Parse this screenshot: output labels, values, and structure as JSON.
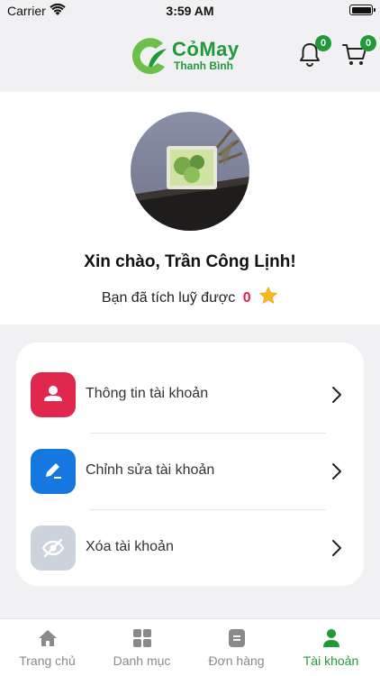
{
  "status_bar": {
    "carrier": "Carrier",
    "time": "3:59 AM"
  },
  "header": {
    "logo_name": "CỏMay",
    "logo_sub": "Thanh Bình",
    "notification_count": "0",
    "cart_count": "0",
    "brand_color": "#1f9a3b"
  },
  "profile": {
    "greeting": "Xin chào, Trần Công Lịnh!",
    "points_prefix": "Bạn đã tích luỹ được",
    "points_value": "0",
    "points_color": "#e01f4f"
  },
  "menu": {
    "items": [
      {
        "label": "Thông tin tài khoản",
        "icon": "user-icon",
        "color": "#e0284f"
      },
      {
        "label": "Chỉnh sửa tài khoản",
        "icon": "edit-icon",
        "color": "#1677e0"
      },
      {
        "label": "Xóa tài khoản",
        "icon": "eye-off-icon",
        "color": "#cdd3dd"
      }
    ]
  },
  "tabs": [
    {
      "label": "Trang chủ",
      "icon": "home-icon",
      "active": false
    },
    {
      "label": "Danh mục",
      "icon": "grid-icon",
      "active": false
    },
    {
      "label": "Đơn hàng",
      "icon": "order-icon",
      "active": false
    },
    {
      "label": "Tài khoản",
      "icon": "user-icon",
      "active": true
    }
  ]
}
